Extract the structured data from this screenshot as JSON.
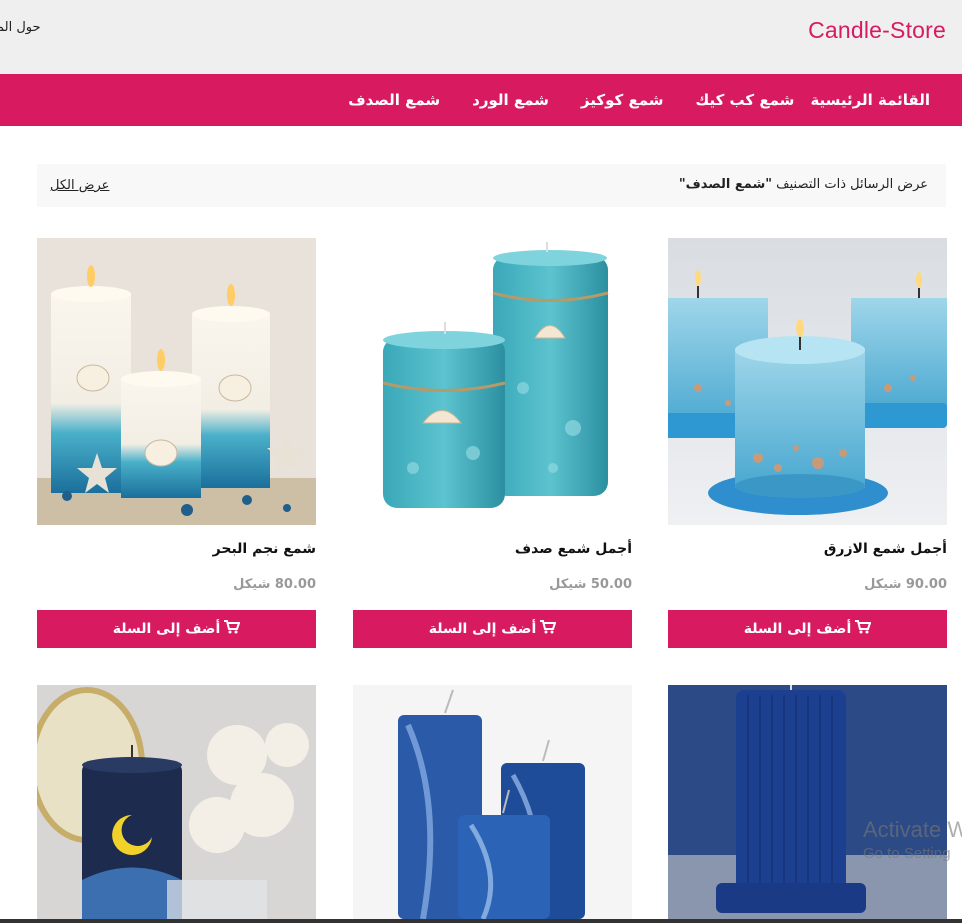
{
  "header": {
    "brand": "Candle-Store",
    "about_link": "حول الم"
  },
  "nav": {
    "items": [
      "القائمة الرئيسية",
      "شمع كب كيك",
      "شمع كوكيز",
      "شمع الورد",
      "شمع الصدف"
    ]
  },
  "filter": {
    "prefix": "عرض الرسائل ذات التصنيف ",
    "category": "\"شمع الصدف\"",
    "view_all": "عرض الكل"
  },
  "products": [
    {
      "name": "أجمل شمع الازرق",
      "price": "90.00 شيكل",
      "button": "أضف إلى السلة"
    },
    {
      "name": "أجمل شمع صدف",
      "price": "50.00 شيكل",
      "button": "أضف إلى السلة"
    },
    {
      "name": "شمع نجم البحر",
      "price": "80.00 شيكل",
      "button": "أضف إلى السلة"
    }
  ],
  "icons": {
    "cart": "cart-icon"
  },
  "colors": {
    "brand": "#d81b60",
    "topbar": "#efefef",
    "price": "#999999"
  },
  "watermark": {
    "line1": "Activate W",
    "line2": "Go to Setting"
  }
}
